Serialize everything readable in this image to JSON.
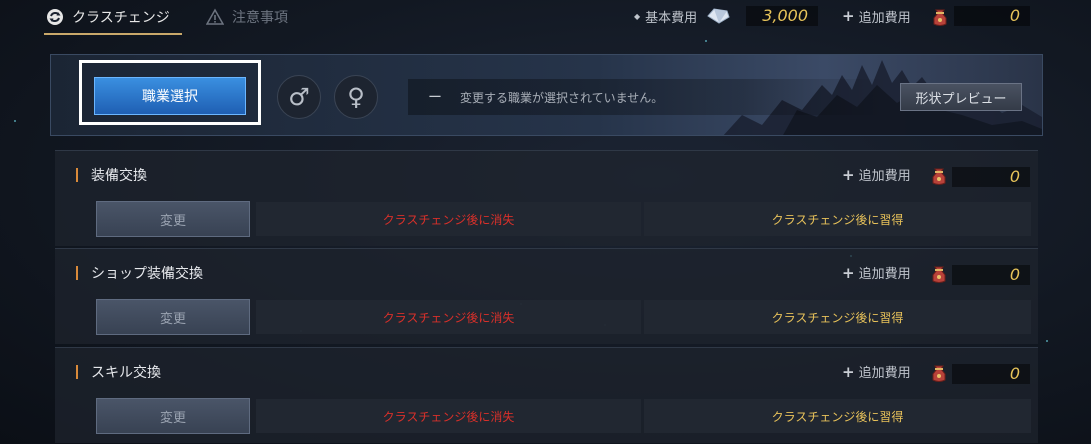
{
  "tabs": [
    {
      "label": "クラスチェンジ",
      "active": true,
      "icon": "refresh-icon"
    },
    {
      "label": "注意事項",
      "active": false,
      "icon": "warning-icon"
    }
  ],
  "costs": {
    "base_label": "基本費用",
    "base_value": "3,000",
    "base_icon": "crystal-icon",
    "add_label": "追加費用",
    "add_value": "0",
    "add_icon": "pouch-icon"
  },
  "job": {
    "select_label": "職業選択",
    "male_symbol": "♂",
    "female_symbol": "♀",
    "message_dash": "ー",
    "message": "変更する職業が選択されていません。",
    "preview_label": "形状プレビュー"
  },
  "sections": [
    {
      "title": "装備交換",
      "add_label": "追加費用",
      "add_value": "0",
      "change_label": "変更",
      "lost_label": "クラスチェンジ後に消失",
      "learn_label": "クラスチェンジ後に習得"
    },
    {
      "title": "ショップ装備交換",
      "add_label": "追加費用",
      "add_value": "0",
      "change_label": "変更",
      "lost_label": "クラスチェンジ後に消失",
      "learn_label": "クラスチェンジ後に習得"
    },
    {
      "title": "スキル交換",
      "add_label": "追加費用",
      "add_value": "0",
      "change_label": "変更",
      "lost_label": "クラスチェンジ後に消失",
      "learn_label": "クラスチェンジ後に習得"
    }
  ],
  "colors": {
    "accent_gold": "#e7c45a",
    "lost_red": "#d9302a",
    "select_blue": "#2f7fd6",
    "section_bar": "#d98a3a"
  }
}
